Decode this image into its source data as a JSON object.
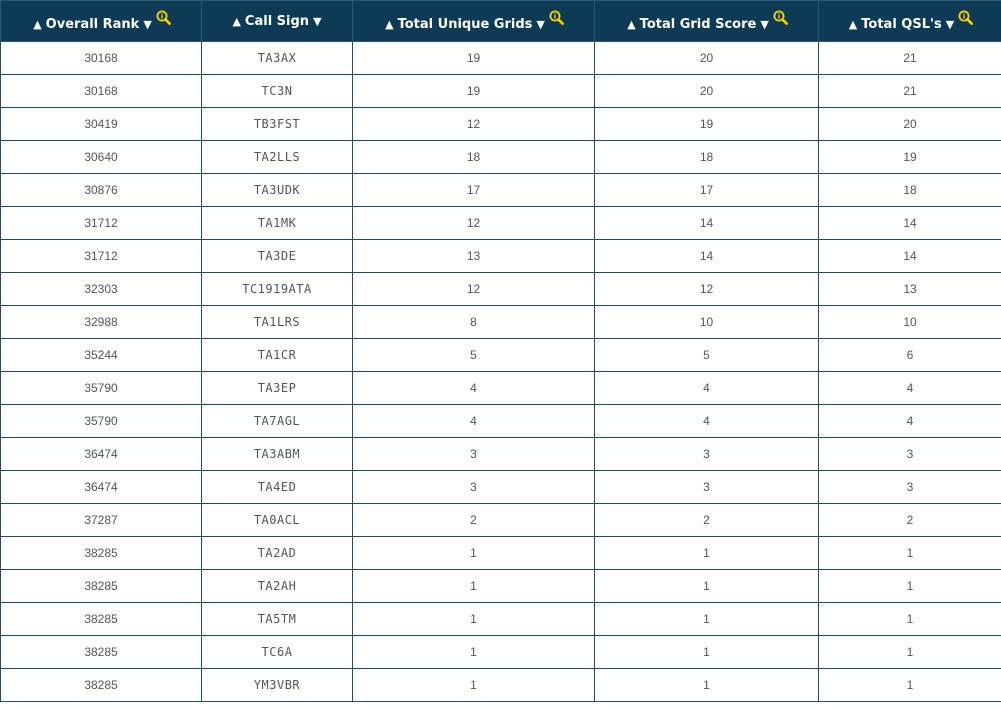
{
  "table": {
    "columns": [
      {
        "label": "Overall Rank",
        "up": "▲",
        "down": "▼",
        "info": true
      },
      {
        "label": "Call Sign",
        "up": "▲",
        "down": "▼",
        "info": false
      },
      {
        "label": "Total Unique Grids",
        "up": "▲",
        "down": "▼",
        "info": true
      },
      {
        "label": "Total Grid Score",
        "up": "▲",
        "down": "▼",
        "info": true
      },
      {
        "label": "Total QSL's",
        "up": "▲",
        "down": "▼",
        "info": true
      }
    ],
    "rows": [
      [
        "30168",
        "TA3AX",
        "19",
        "20",
        "21"
      ],
      [
        "30168",
        "TC3N",
        "19",
        "20",
        "21"
      ],
      [
        "30419",
        "TB3FST",
        "12",
        "19",
        "20"
      ],
      [
        "30640",
        "TA2LLS",
        "18",
        "18",
        "19"
      ],
      [
        "30876",
        "TA3UDK",
        "17",
        "17",
        "18"
      ],
      [
        "31712",
        "TA1MK",
        "12",
        "14",
        "14"
      ],
      [
        "31712",
        "TA3DE",
        "13",
        "14",
        "14"
      ],
      [
        "32303",
        "TC1919ATA",
        "12",
        "12",
        "13"
      ],
      [
        "32988",
        "TA1LRS",
        "8",
        "10",
        "10"
      ],
      [
        "35244",
        "TA1CR",
        "5",
        "5",
        "6"
      ],
      [
        "35790",
        "TA3EP",
        "4",
        "4",
        "4"
      ],
      [
        "35790",
        "TA7AGL",
        "4",
        "4",
        "4"
      ],
      [
        "36474",
        "TA3ABM",
        "3",
        "3",
        "3"
      ],
      [
        "36474",
        "TA4ED",
        "3",
        "3",
        "3"
      ],
      [
        "37287",
        "TA0ACL",
        "2",
        "2",
        "2"
      ],
      [
        "38285",
        "TA2AD",
        "1",
        "1",
        "1"
      ],
      [
        "38285",
        "TA2AH",
        "1",
        "1",
        "1"
      ],
      [
        "38285",
        "TA5TM",
        "1",
        "1",
        "1"
      ],
      [
        "38285",
        "TC6A",
        "1",
        "1",
        "1"
      ],
      [
        "38285",
        "YM3VBR",
        "1",
        "1",
        "1"
      ]
    ]
  },
  "icons": {
    "info": "info-magnifier-icon"
  },
  "colors": {
    "header_bg": "#0d3a55",
    "header_text": "#ffffff",
    "cell_text": "#555555",
    "border": "#1f4d66",
    "info_icon": "#ffd200"
  }
}
